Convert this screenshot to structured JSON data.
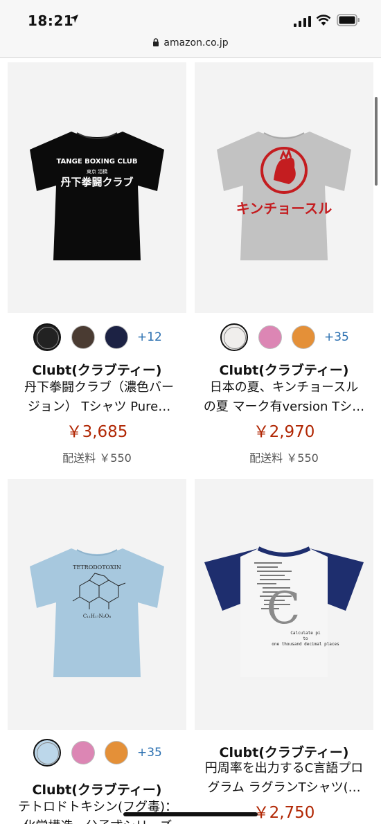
{
  "status": {
    "time": "18:21"
  },
  "browser": {
    "url": "amazon.co.jp"
  },
  "products": [
    {
      "print_lines": [
        "TANGE BOXING CLUB",
        "東京 泪橋",
        "丹下拳闘クラブ"
      ],
      "swatches": [
        "#222222",
        "#4a3b32",
        "#1c2244"
      ],
      "more_colors": "+12",
      "brand": "Clubt(クラブティー)",
      "title_line1": "丹下拳闘クラブ（濃色バー",
      "title_line2": "ジョン） Tシャツ Pure…",
      "price": "￥3,685",
      "shipping": "配送料 ￥550"
    },
    {
      "print_lines": [
        "キンチョースル"
      ],
      "swatches": [
        "#f0eeec",
        "#dc86b4",
        "#e49038"
      ],
      "more_colors": "+35",
      "brand": "Clubt(クラブティー)",
      "title_line1": "日本の夏、キンチョースル",
      "title_line2": "の夏 マーク有version Tシ…",
      "price": "￥2,970",
      "shipping": "配送料 ￥550"
    },
    {
      "print_lines": [
        "TETRODOTOXIN",
        "C₁₁H₁₇N₃O₈"
      ],
      "swatches": [
        "#bcd7ea",
        "#dc86b4",
        "#e49038"
      ],
      "more_colors": "+35",
      "brand": "Clubt(クラブティー)",
      "title_line1": "テトロドトキシン(フグ毒)：",
      "title_line2": "化学構造・分子式シリーズ"
    },
    {
      "print_lines": [
        "C",
        "Calculate pi",
        "to",
        "one thousand decimal places"
      ],
      "brand": "Clubt(クラブティー)",
      "title_line1": "円周率を出力するC言語プロ",
      "title_line2": "グラム ラグランTシャツ(…",
      "price": "￥2,750"
    }
  ],
  "colors": {
    "price": "#b12704",
    "link": "#2a6fb0"
  }
}
